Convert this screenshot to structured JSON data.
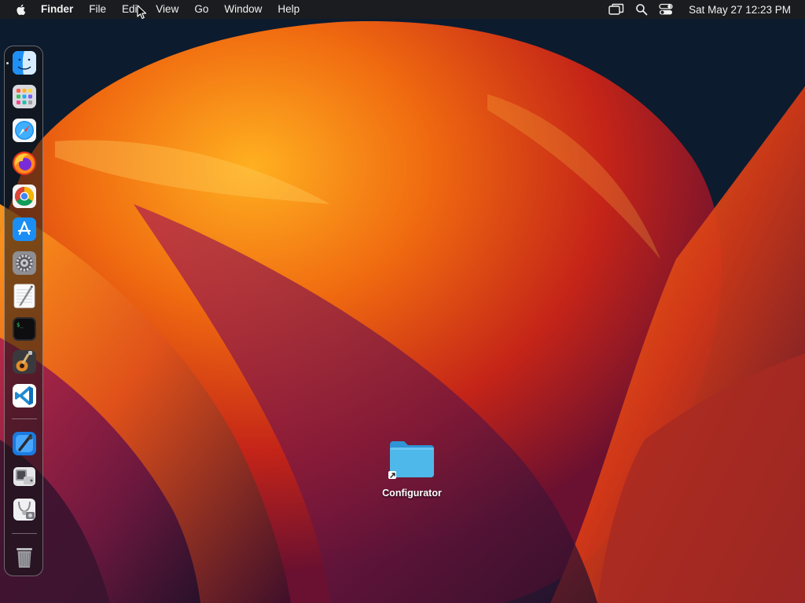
{
  "menubar": {
    "app_name": "Finder",
    "items": [
      "File",
      "Edit",
      "View",
      "Go",
      "Window",
      "Help"
    ],
    "status_icons": [
      "screen-mirroring-icon",
      "spotlight-search-icon",
      "control-center-icon"
    ],
    "clock": "Sat May 27  12:23 PM"
  },
  "dock": {
    "apps": [
      {
        "name": "Finder",
        "icon": "finder-icon",
        "running": true
      },
      {
        "name": "Launchpad",
        "icon": "launchpad-icon"
      },
      {
        "name": "Safari",
        "icon": "safari-icon"
      },
      {
        "name": "Firefox",
        "icon": "firefox-icon"
      },
      {
        "name": "Google Chrome",
        "icon": "chrome-icon"
      },
      {
        "name": "App Store",
        "icon": "app-store-icon"
      },
      {
        "name": "System Settings",
        "icon": "system-settings-icon"
      },
      {
        "name": "TextEdit",
        "icon": "textedit-icon"
      },
      {
        "name": "Terminal",
        "icon": "terminal-icon"
      },
      {
        "name": "GarageBand",
        "icon": "garageband-icon"
      },
      {
        "name": "Visual Studio Code",
        "icon": "vscode-icon"
      }
    ],
    "utilities": [
      {
        "name": "Xcode",
        "icon": "xcode-icon"
      },
      {
        "name": "Boot Camp Assistant",
        "icon": "bootcamp-icon"
      },
      {
        "name": "Disk Utility",
        "icon": "disk-utility-icon"
      }
    ],
    "trash": {
      "name": "Trash",
      "icon": "trash-icon"
    }
  },
  "desktop": {
    "folder": {
      "label": "Configurator",
      "icon": "folder-alias-icon",
      "color": "#4fb8ea"
    }
  },
  "colors": {
    "menubar_bg": "#1c1c1e",
    "wallpaper_orange": "#f07a12",
    "wallpaper_red": "#c8261a",
    "wallpaper_magenta": "#7a1b4a",
    "wallpaper_navy": "#0d1b2e"
  }
}
